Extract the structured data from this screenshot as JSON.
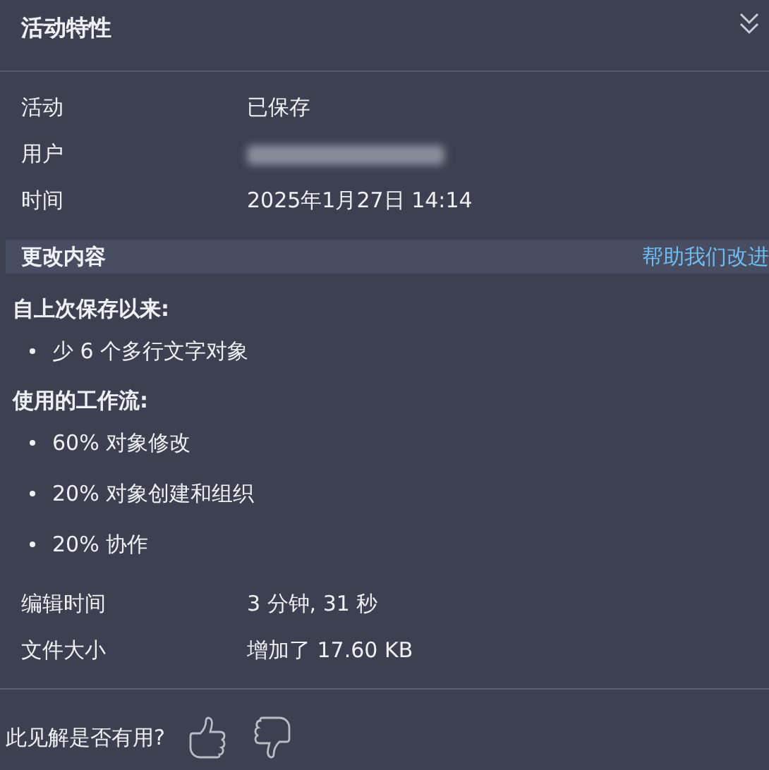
{
  "panel": {
    "title": "活动特性"
  },
  "details": [
    {
      "label": "活动",
      "value": "已保存",
      "kind": "text"
    },
    {
      "label": "用户",
      "kind": "redacted"
    },
    {
      "label": "时间",
      "value": "2025年1月27日 14:14",
      "kind": "text"
    }
  ],
  "changes": {
    "title": "更改内容",
    "help_link": "帮助我们改进",
    "groups": [
      {
        "heading": "自上次保存以来:",
        "items": [
          "少 6 个多行文字对象"
        ]
      },
      {
        "heading": "使用的工作流:",
        "items": [
          "60% 对象修改",
          "20% 对象创建和组织",
          "20% 协作"
        ]
      }
    ]
  },
  "stats": [
    {
      "label": "编辑时间",
      "value": "3 分钟, 31 秒"
    },
    {
      "label": "文件大小",
      "value": "增加了 17.60 KB"
    }
  ],
  "feedback": {
    "question": "此见解是否有用?"
  }
}
